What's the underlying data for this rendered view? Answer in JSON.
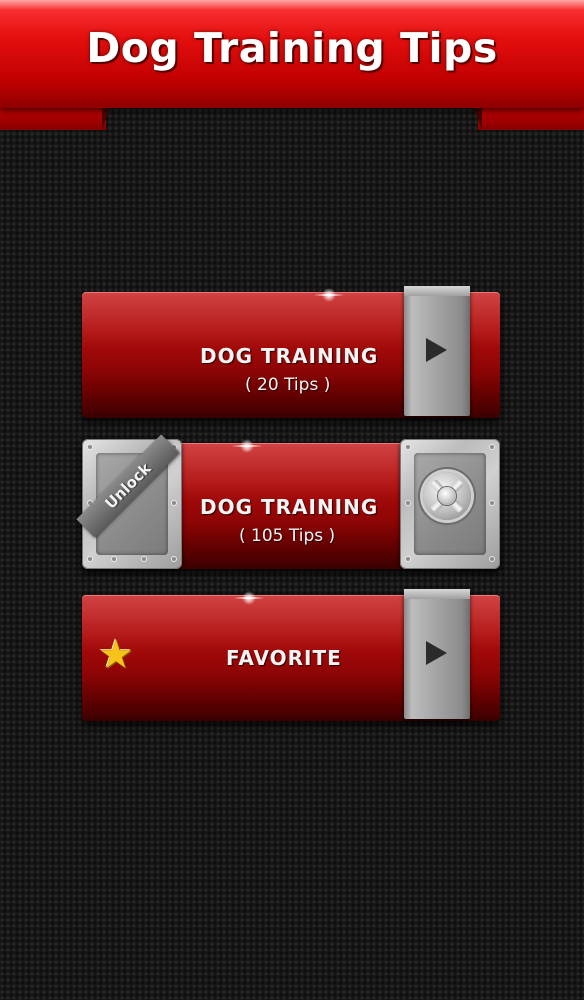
{
  "header": {
    "title": "Dog Training Tips"
  },
  "menu": {
    "training_basic": {
      "title": "DOG TRAINING",
      "subtitle": "( 20 Tips )"
    },
    "training_locked": {
      "title": "DOG TRAINING",
      "subtitle": "( 105 Tips )",
      "badge": "Unlock"
    },
    "favorite": {
      "title": "FAVORITE"
    }
  },
  "icons": {
    "play": "play-icon",
    "star": "star-icon",
    "vault": "vault-icon"
  },
  "colors": {
    "banner_red": "#e50f0f",
    "button_red": "#b10d0d",
    "metal_gray": "#bdbdbd",
    "star_gold": "#f7c21a",
    "background": "#161616"
  }
}
